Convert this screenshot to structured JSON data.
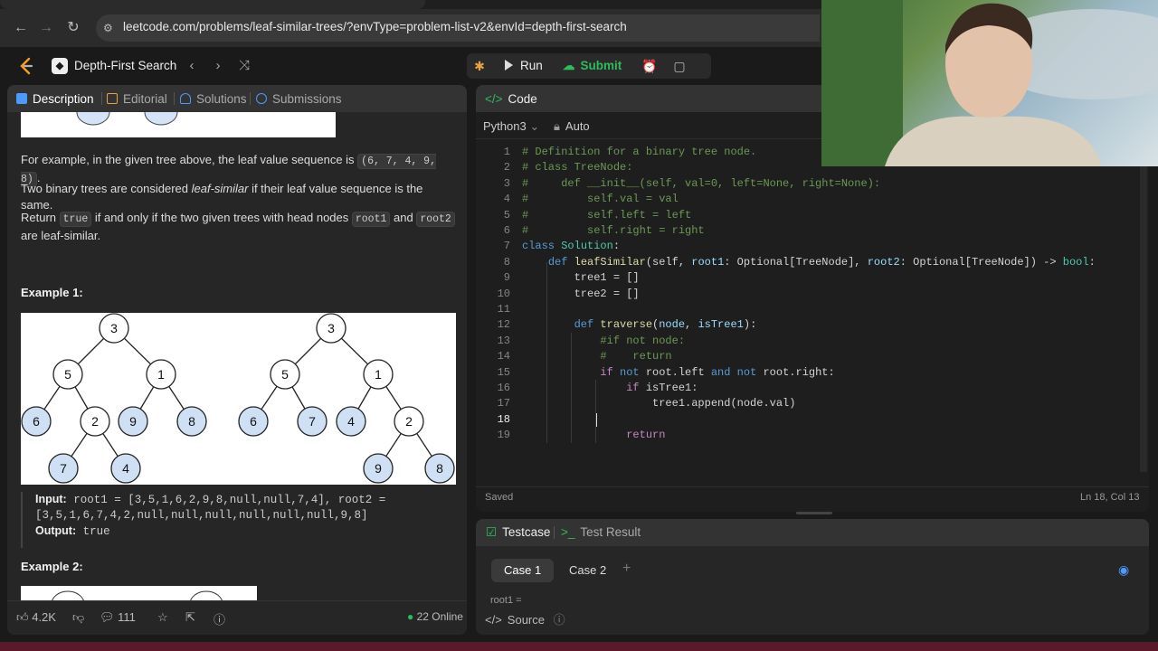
{
  "browser": {
    "url": "leetcode.com/problems/leaf-similar-trees/?envType=problem-list-v2&envId=depth-first-search"
  },
  "header": {
    "list_name": "Depth-First Search",
    "run_label": "Run",
    "submit_label": "Submit"
  },
  "left_tabs": [
    {
      "label": "Description",
      "color": "#4c9aff"
    },
    {
      "label": "Editorial",
      "color": "#e8a33c"
    },
    {
      "label": "Solutions",
      "color": "#4c9aff"
    },
    {
      "label": "Submissions",
      "color": "#4c9aff"
    }
  ],
  "description": {
    "p1_before": "For example, in the given tree above, the leaf value sequence is ",
    "p1_code": "(6, 7, 4, 9, 8)",
    "p1_after": ".",
    "p2_before": "Two binary trees are considered ",
    "p2_em": "leaf-similar",
    "p2_after": " if their leaf value sequence is the same.",
    "p3_a": "Return ",
    "p3_code1": "true",
    "p3_b": " if and only if the two given trees with head nodes ",
    "p3_code2": "root1",
    "p3_c": " and ",
    "p3_code3": "root2",
    "p3_d": " are leaf-similar.",
    "example1_title": "Example 1:",
    "input_label": "Input:",
    "input_line1": " root1 = [3,5,1,6,2,9,8,null,null,7,4], root2 =",
    "input_line2": "[3,5,1,6,7,4,2,null,null,null,null,null,null,9,8]",
    "output_label": "Output:",
    "output_value": " true",
    "example2_title": "Example 2:"
  },
  "tree1": {
    "nodes": [
      "3",
      "5",
      "1",
      "6",
      "2",
      "9",
      "8",
      "7",
      "4"
    ]
  },
  "tree2": {
    "nodes": [
      "3",
      "5",
      "1",
      "6",
      "7",
      "4",
      "2",
      "9",
      "8"
    ]
  },
  "left_footer": {
    "likes": "4.2K",
    "comments": "111",
    "online": "22 Online"
  },
  "editor": {
    "tab": "Code",
    "language": "Python3",
    "mode": "Auto",
    "saved": "Saved",
    "cursor": "Ln 18, Col 13",
    "line_numbers": [
      "1",
      "2",
      "3",
      "4",
      "5",
      "6",
      "7",
      "8",
      "9",
      "10",
      "11",
      "12",
      "13",
      "14",
      "15",
      "16",
      "17",
      "18",
      "19"
    ]
  },
  "testcase": {
    "tab1": "Testcase",
    "tab2": "Test Result",
    "case1": "Case 1",
    "case2": "Case 2",
    "root_label": "root1 =",
    "source": "Source"
  }
}
